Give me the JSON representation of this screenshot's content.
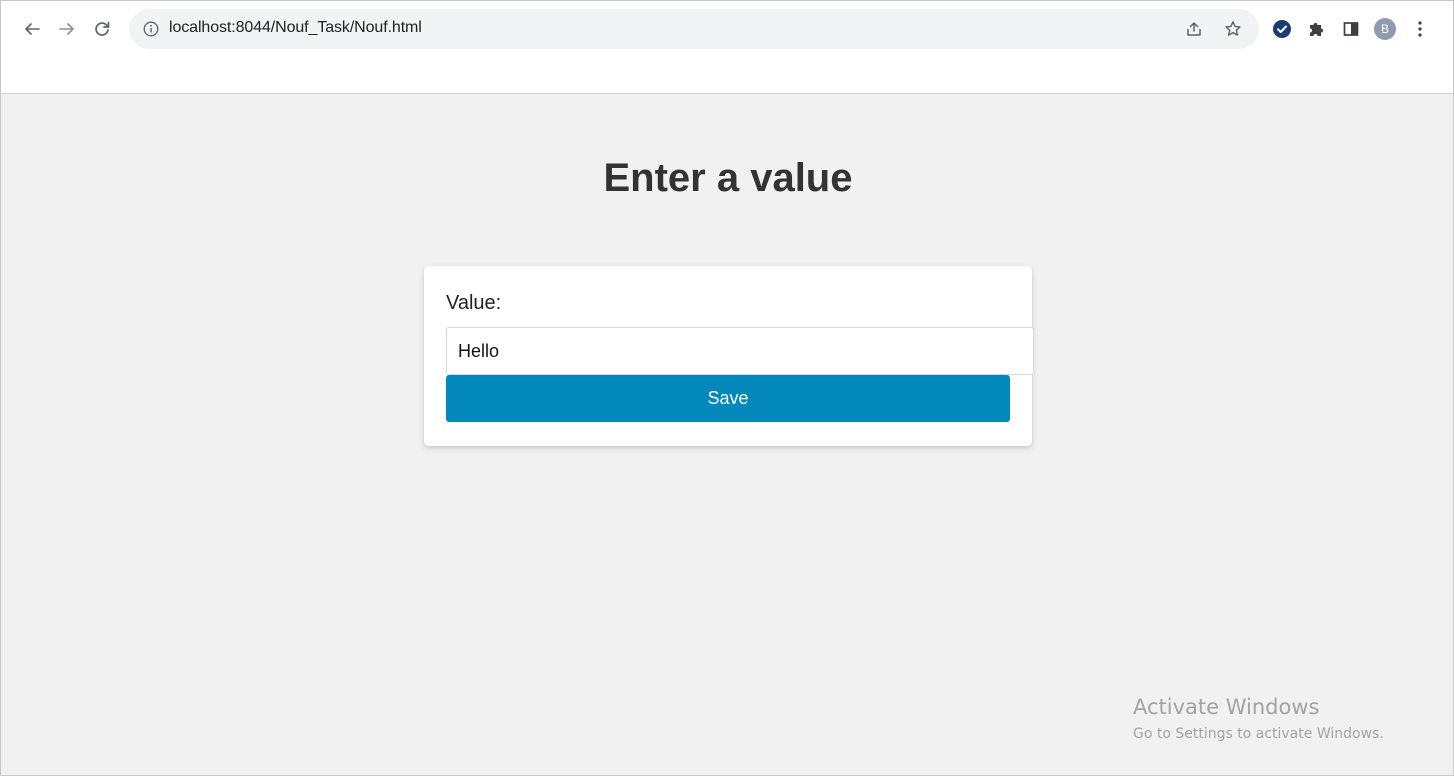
{
  "browser": {
    "url": "localhost:8044/Nouf_Task/Nouf.html",
    "avatar_initial": "B",
    "icons": {
      "back": "arrow-left-icon",
      "forward": "arrow-right-icon",
      "reload": "reload-icon",
      "site_info": "info-icon",
      "share": "share-icon",
      "bookmark": "star-icon",
      "extension_check": "check-circle-icon",
      "extensions": "puzzle-icon",
      "side_panel": "side-panel-icon",
      "menu": "kebab-menu-icon"
    }
  },
  "page": {
    "heading": "Enter a value",
    "form": {
      "label": "Value:",
      "input_value": "Hello",
      "save_label": "Save"
    }
  },
  "watermark": {
    "title": "Activate Windows",
    "subtitle": "Go to Settings to activate Windows."
  },
  "colors": {
    "page_background": "#f1f1f1",
    "button_background": "#0288bb",
    "heading_text": "#333333",
    "extension_check": "#1a3c73"
  }
}
